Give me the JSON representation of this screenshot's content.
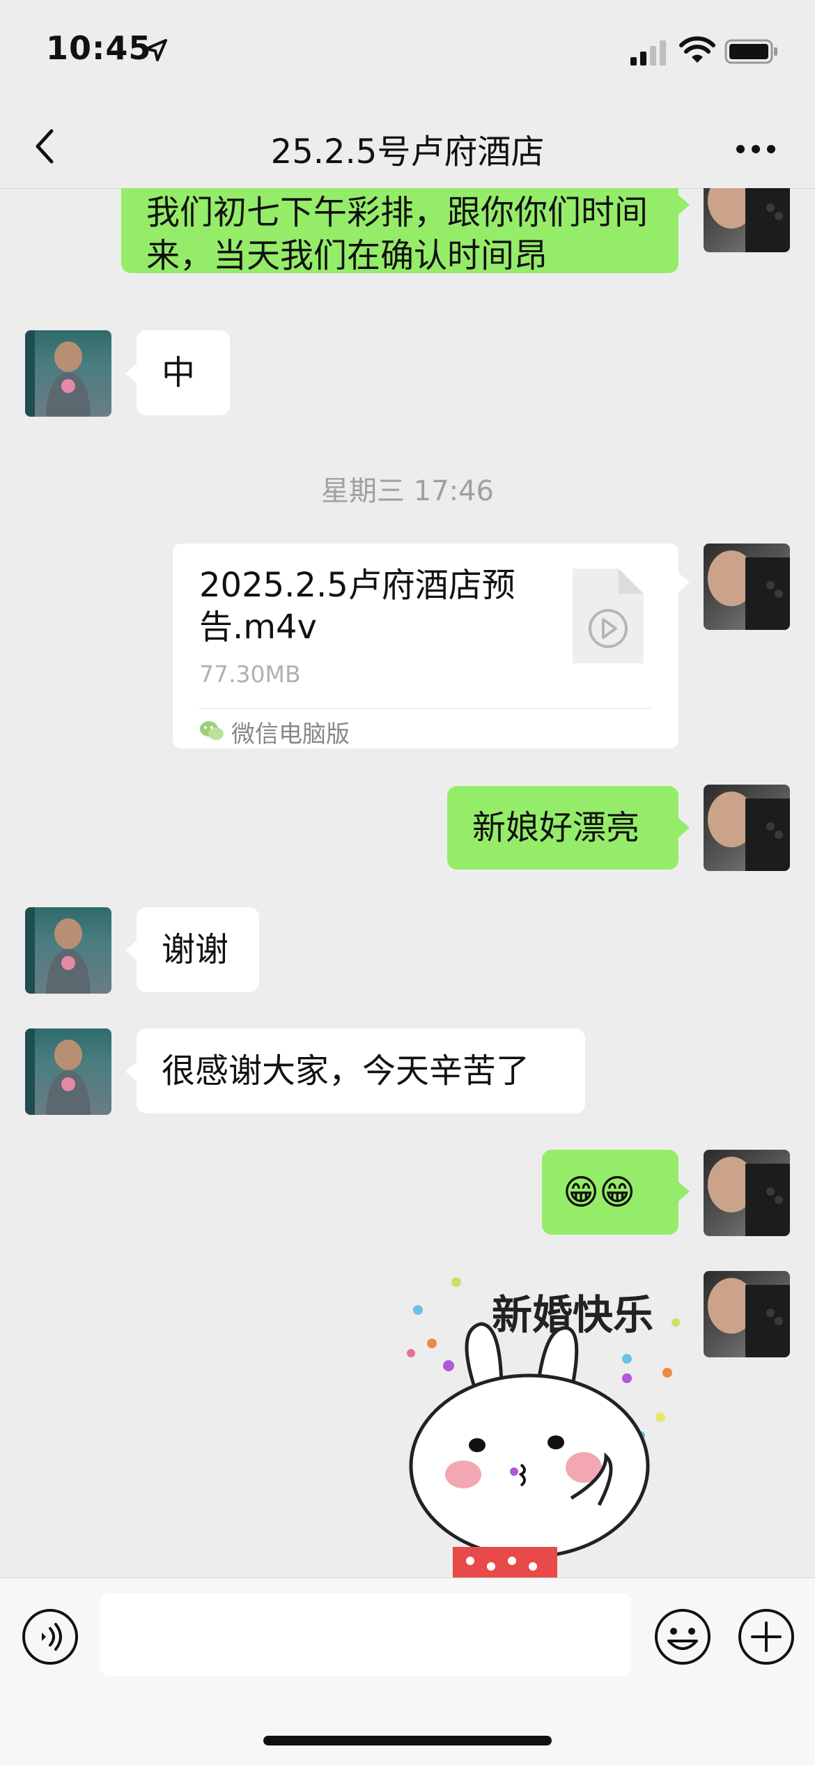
{
  "status_bar": {
    "time": "10:45"
  },
  "header": {
    "title": "25.2.5号卢府酒店"
  },
  "messages": [
    {
      "side": "me",
      "type": "text",
      "text": "我们初七下午彩排，跟你你们时间来，当天我们在确认时间昂"
    },
    {
      "side": "them",
      "type": "text",
      "text": "中"
    },
    {
      "type": "timestamp",
      "text": "星期三 17:46"
    },
    {
      "side": "me",
      "type": "file",
      "name": "2025.2.5卢府酒店预告.m4v",
      "size": "77.30MB",
      "source": "微信电脑版"
    },
    {
      "side": "me",
      "type": "text",
      "text": "新娘好漂亮"
    },
    {
      "side": "them",
      "type": "text",
      "text": "谢谢"
    },
    {
      "side": "them",
      "type": "text",
      "text": "很感谢大家，今天辛苦了"
    },
    {
      "side": "me",
      "type": "text",
      "text": "😁😁"
    },
    {
      "side": "me",
      "type": "sticker",
      "caption": "新婚快乐"
    }
  ],
  "colors": {
    "my_bubble": "#95ec69",
    "their_bubble": "#ffffff",
    "background": "#ededed"
  },
  "icons": [
    "back-chevron-icon",
    "more-dots-icon",
    "voice-icon",
    "emoji-icon",
    "plus-icon",
    "video-file-icon",
    "wechat-pc-icon"
  ]
}
